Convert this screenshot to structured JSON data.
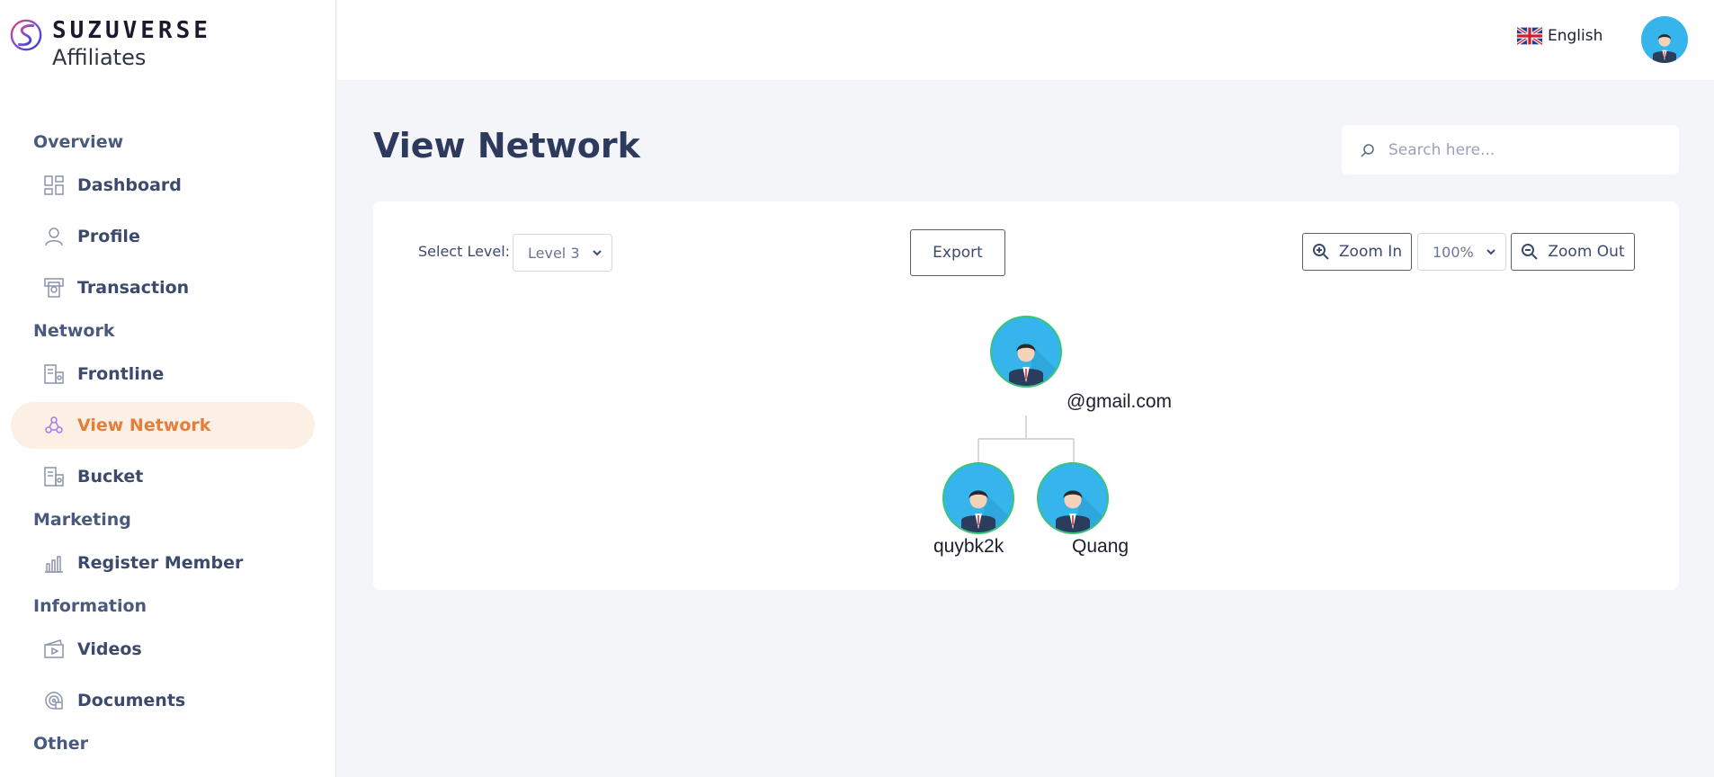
{
  "brand": {
    "name": "SUZUVERSE",
    "subtitle": "Affiliates"
  },
  "sidebar": {
    "sections": [
      {
        "title": "Overview",
        "items": [
          {
            "label": "Dashboard",
            "icon": "dashboard-icon"
          },
          {
            "label": "Profile",
            "icon": "profile-icon"
          },
          {
            "label": "Transaction",
            "icon": "transaction-icon"
          }
        ]
      },
      {
        "title": "Network",
        "items": [
          {
            "label": "Frontline",
            "icon": "frontline-icon"
          },
          {
            "label": "View Network",
            "icon": "network-icon",
            "active": true
          },
          {
            "label": "Bucket",
            "icon": "bucket-icon"
          }
        ]
      },
      {
        "title": "Marketing",
        "items": [
          {
            "label": "Register Member",
            "icon": "chart-icon"
          }
        ]
      },
      {
        "title": "Information",
        "items": [
          {
            "label": "Videos",
            "icon": "videos-icon"
          },
          {
            "label": "Documents",
            "icon": "documents-icon"
          }
        ]
      },
      {
        "title": "Other",
        "items": []
      }
    ]
  },
  "header": {
    "language": "English"
  },
  "main": {
    "title": "View Network",
    "search_placeholder": "Search here...",
    "controls": {
      "level_label": "Select Level:",
      "level_value": "Level 3",
      "export_label": "Export",
      "zoom_in_label": "Zoom In",
      "zoom_value": "100%",
      "zoom_out_label": "Zoom Out"
    },
    "tree": {
      "root": {
        "label": "@gmail.com"
      },
      "children": [
        {
          "label": "quybk2k"
        },
        {
          "label": "Quang"
        }
      ]
    }
  },
  "colors": {
    "accent": "#e37e3d",
    "active_bg": "#fcefe4",
    "avatar_bg": "#35b5eb",
    "avatar_ring": "#39c47a"
  }
}
